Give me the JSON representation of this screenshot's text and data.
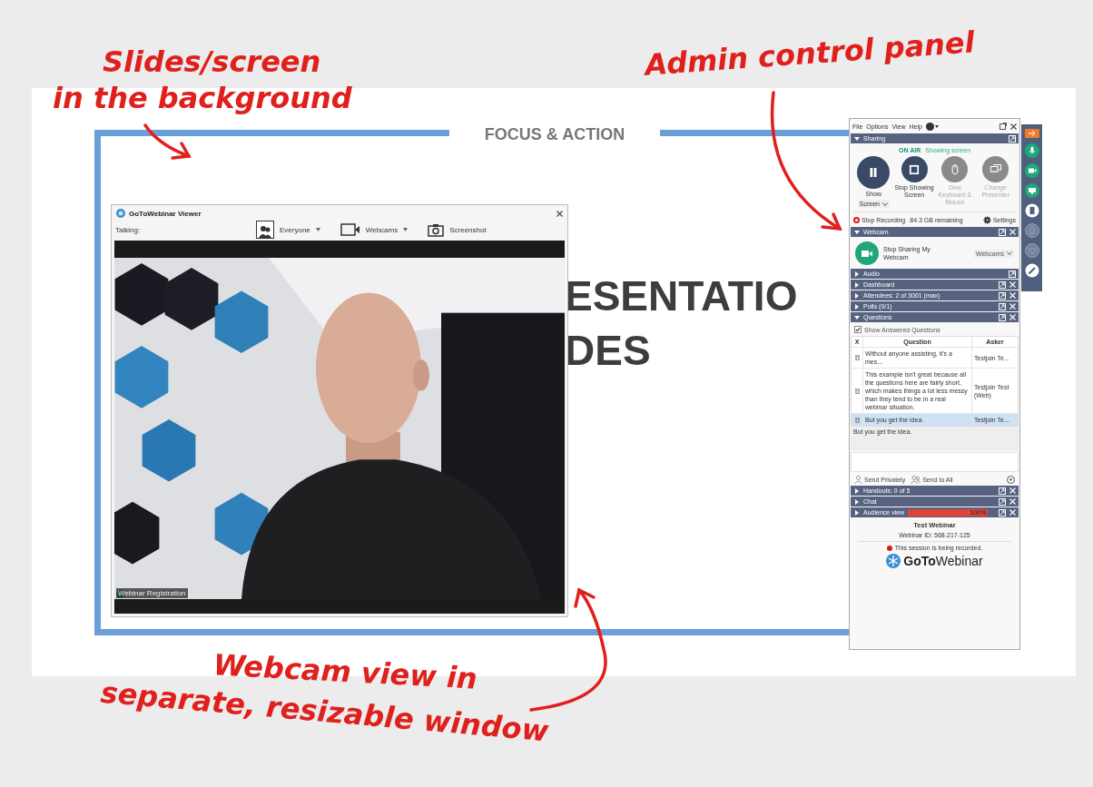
{
  "annotations": [
    {
      "kind": "slides",
      "lines": [
        "Slides/screen",
        "in the background"
      ]
    },
    {
      "kind": "panel",
      "lines": [
        "Admin control panel"
      ]
    },
    {
      "kind": "webcam",
      "lines": [
        "Webcam view in",
        "separate, resizable window"
      ]
    }
  ],
  "slide": {
    "title": "FOCUS & ACTION",
    "heading_lines": [
      "ESENTATIO",
      "DES"
    ]
  },
  "viewer": {
    "title": "GoToWebinar Viewer",
    "talking_label": "Talking:",
    "toolbar": [
      {
        "kind": "people",
        "label": "Everyone",
        "dropdown": true
      },
      {
        "kind": "webcam",
        "label": "Webcams",
        "dropdown": true
      },
      {
        "kind": "camera",
        "label": "Screenshot",
        "dropdown": false
      }
    ],
    "video_label": "Webinar Registration"
  },
  "panel": {
    "menu": [
      "File",
      "Options",
      "View",
      "Help"
    ],
    "sections": [
      {
        "kind": "sharing",
        "title": "Sharing",
        "expanded": true,
        "closable": false,
        "status": "ON AIR",
        "status_detail": "Showing screen",
        "buttons": [
          {
            "kind": "pause",
            "label": "Show",
            "dropdown": "Screen",
            "disabled": false
          },
          {
            "kind": "stop",
            "label": "Stop Showing Screen",
            "disabled": false
          },
          {
            "kind": "mouse",
            "label": "Give Keyboard & Mouse",
            "disabled": true
          },
          {
            "kind": "screens",
            "label": "Change Presenter",
            "disabled": true
          }
        ],
        "recording": {
          "label": "Stop Recording",
          "space": "84.3 GB remaining",
          "settings": "Settings"
        }
      },
      {
        "kind": "webcam",
        "title": "Webcam",
        "expanded": true,
        "closable": true,
        "label": "Stop Sharing My Webcam",
        "dropdown": "Webcams"
      },
      {
        "kind": "plain",
        "title": "Audio",
        "expanded": false,
        "closable": false
      },
      {
        "kind": "plain",
        "title": "Dashboard",
        "expanded": false,
        "closable": true
      },
      {
        "kind": "plain",
        "title": "Attendees:  2 of 3001 (max)",
        "expanded": false,
        "closable": true
      },
      {
        "kind": "plain",
        "title": "Polls (0/1)",
        "expanded": false,
        "closable": true
      },
      {
        "kind": "questions",
        "title": "Questions",
        "expanded": true,
        "closable": true,
        "show_answered": {
          "label": "Show Answered Questions",
          "checked": true
        },
        "columns": [
          "X",
          "Question",
          "Asker"
        ],
        "rows": [
          {
            "question": "Without anyone assisting, it's a mes...",
            "asker": "Testjoin Te...",
            "selected": false
          },
          {
            "question": "This example isn't great because all the questions here are fairly short, which makes things a lot less messy than they tend to be in a real webinar situation.",
            "asker": "Testjoin Test (Web)",
            "selected": false
          },
          {
            "question": "But you get the idea.",
            "asker": "Testjoin Te...",
            "selected": true
          }
        ],
        "preview": "But you get the idea.",
        "actions": [
          {
            "kind": "private",
            "label": "Send Privately"
          },
          {
            "kind": "all",
            "label": "Send to All"
          }
        ]
      },
      {
        "kind": "plain",
        "title": "Handouts: 0 of 5",
        "expanded": false,
        "closable": true
      },
      {
        "kind": "plain",
        "title": "Chat",
        "expanded": false,
        "closable": true
      },
      {
        "kind": "audience",
        "title": "Audience view",
        "expanded": false,
        "closable": true,
        "level": 1,
        "reading": "100%"
      }
    ],
    "footer": {
      "title": "Test Webinar",
      "webinar_id": "Webinar ID: 568-217-125",
      "recording_notice": "This session is being recorded.",
      "logo": "**GoTo**Webinar"
    }
  }
}
